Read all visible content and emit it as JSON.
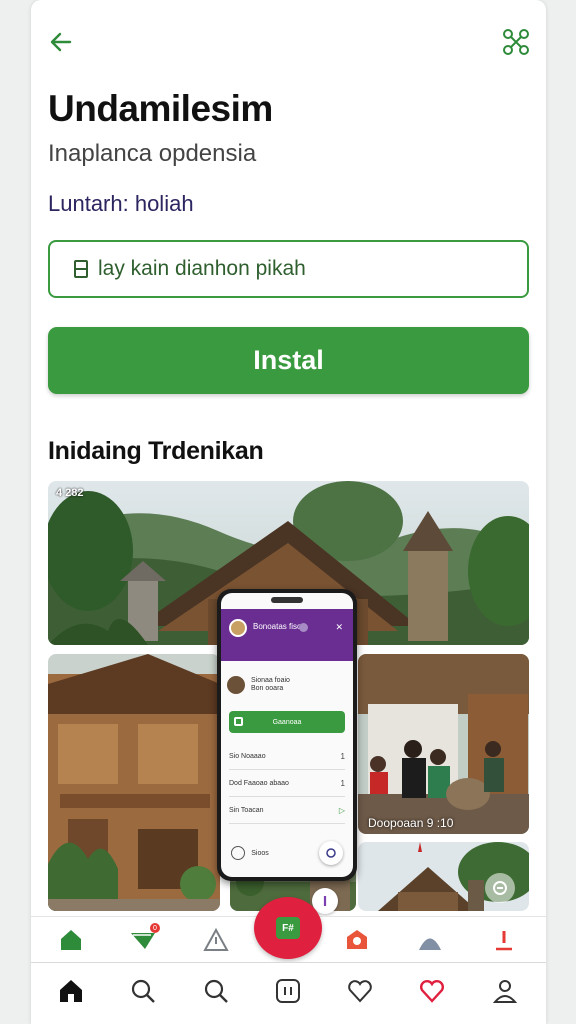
{
  "app": {
    "title": "Undamilesim",
    "subtitle": "Inaplanca opdensia",
    "meta": "Luntarh: holiah"
  },
  "search": {
    "value": "lay kain dianhon pikah",
    "icon": "document-icon"
  },
  "install_button": {
    "label": "Instal"
  },
  "section": {
    "title": "Inidaing Trdenikan"
  },
  "gallery": {
    "top_status": "4 282",
    "right_caption": "Doopoaan 9 :10"
  },
  "phone": {
    "header_title": "Bonoatas fiso",
    "profile_name": "Sionaa foaio",
    "profile_line": "Bon ooara",
    "cta_label": "Gaanoaa",
    "rows": [
      {
        "label": "Sio Noaaao",
        "right": "1"
      },
      {
        "label": "Dod Faaoao abaao",
        "right": "1"
      },
      {
        "label": "Sin Toacan",
        "right": "▷"
      }
    ],
    "bottom_label": "Sioos"
  },
  "categories": [
    {
      "name": "home-icon",
      "color": "#2e8b3a"
    },
    {
      "name": "leaf-icon",
      "color": "#2e8b3a",
      "badge": "0"
    },
    {
      "name": "warning-icon",
      "color": "#7b7f86"
    },
    {
      "name": "shield-icon",
      "color": "#e8553a"
    },
    {
      "name": "user-group-icon",
      "color": "#8190a5"
    },
    {
      "name": "pin-icon",
      "color": "#e53935"
    }
  ],
  "fab": {
    "label": "F#"
  },
  "bottom_nav": [
    {
      "name": "home-icon"
    },
    {
      "name": "search-icon"
    },
    {
      "name": "search-icon"
    },
    {
      "name": "apps-icon"
    },
    {
      "name": "heart-icon"
    },
    {
      "name": "heart-icon",
      "color": "#e0203f"
    },
    {
      "name": "profile-icon"
    }
  ],
  "colors": {
    "accent": "#3a9a3f",
    "purple": "#6a2e93",
    "red": "#e0203f"
  }
}
